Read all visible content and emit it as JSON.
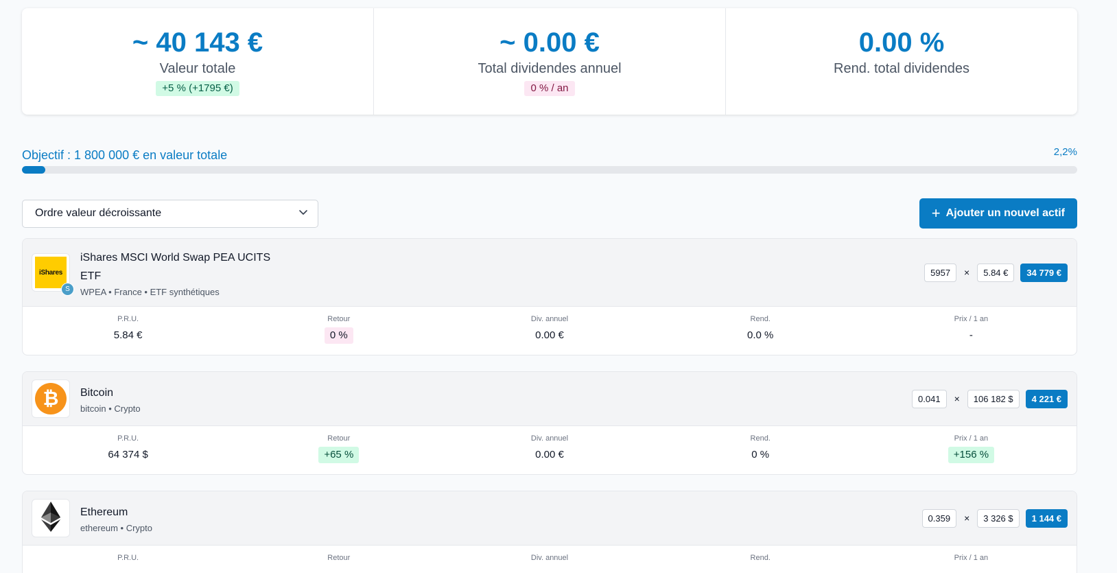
{
  "summary": {
    "total_value": "~ 40 143 €",
    "total_value_label": "Valeur totale",
    "total_value_change": "+5 % (+1795 €)",
    "dividends_value": "~ 0.00 €",
    "dividends_label": "Total dividendes annuel",
    "dividends_rate": "0 % / an",
    "yield_value": "0.00 %",
    "yield_label": "Rend. total dividendes"
  },
  "goal": {
    "text": "Objectif : 1 800 000 € en valeur totale",
    "percent_label": "2,2%",
    "progress_fraction": 0.022
  },
  "controls": {
    "sort_selected": "Ordre valeur décroissante",
    "add_button": "Ajouter un nouvel actif"
  },
  "stat_labels": {
    "pru": "P.R.U.",
    "return": "Retour",
    "div": "Div. annuel",
    "yield": "Rend.",
    "price_1y": "Prix / 1 an"
  },
  "assets": [
    {
      "name": "iShares MSCI World Swap PEA UCITS ETF",
      "sub": "WPEA • France • ETF synthétiques",
      "logo_text": "iShares",
      "badge": "S",
      "quantity": "5957",
      "price": "5.84 €",
      "total": "34 779 €",
      "pru": "5.84 €",
      "return": "0 %",
      "div": "0.00 €",
      "yield": "0.0 %",
      "price_1y": "-"
    },
    {
      "name": "Bitcoin",
      "sub": "bitcoin • Crypto",
      "logo_text": "₿",
      "quantity": "0.041",
      "price": "106 182 $",
      "total": "4 221 €",
      "pru": "64 374 $",
      "return": "+65 %",
      "div": "0.00 €",
      "yield": "0 %",
      "price_1y": "+156 %"
    },
    {
      "name": "Ethereum",
      "sub": "ethereum • Crypto",
      "quantity": "0.359",
      "price": "3 326 $",
      "total": "1 144 €"
    }
  ],
  "colors": {
    "accent": "#0a7cc4",
    "positive_bg": "#d1fae5",
    "neutral_bg": "#fce7f3",
    "ishares_yellow": "#ffcc00",
    "bitcoin_orange": "#f7931a"
  },
  "icons": {
    "select": "chevron-down-icon",
    "add": "plus-icon",
    "bitcoin": "bitcoin-icon",
    "ethereum": "ethereum-icon"
  }
}
